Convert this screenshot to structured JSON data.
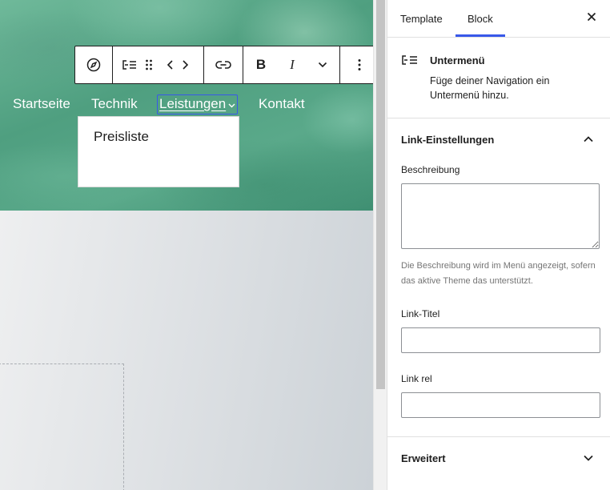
{
  "navigation": {
    "items": [
      "Startseite",
      "Technik",
      "Leistungen",
      "Kontakt"
    ],
    "active_item": "Leistungen",
    "submenu": {
      "items": [
        "Preisliste"
      ]
    }
  },
  "toolbar": {
    "buttons": [
      {
        "name": "navigation-block-icon",
        "icon": "compass-icon"
      },
      {
        "name": "submenu-parent-button",
        "icon": "submenu-icon"
      },
      {
        "name": "drag-handle",
        "icon": "drag-handle-icon"
      },
      {
        "name": "move-left-right",
        "icon": "chevron-left-right-icon"
      },
      {
        "name": "link-button",
        "icon": "link-icon"
      },
      {
        "name": "bold-button",
        "icon": "bold-icon",
        "label": "B"
      },
      {
        "name": "italic-button",
        "icon": "italic-icon",
        "label": "I"
      },
      {
        "name": "more-rich-text-button",
        "icon": "chevron-down-icon"
      },
      {
        "name": "options-button",
        "icon": "vertical-ellipsis-icon"
      }
    ]
  },
  "sidebar": {
    "tabs": [
      {
        "label": "Template",
        "active": false
      },
      {
        "label": "Block",
        "active": true
      }
    ],
    "close_icon": "close-icon",
    "block_card": {
      "icon": "submenu-icon",
      "title": "Untermenü",
      "description": "Füge deiner Navigation ein Untermenü hinzu."
    },
    "link_settings": {
      "title": "Link-Einstellungen",
      "expanded": true,
      "description_label": "Beschreibung",
      "description_value": "",
      "description_help": "Die Beschreibung wird im Menü angezeigt, sofern das aktive Theme das unterstützt.",
      "link_title_label": "Link-Titel",
      "link_title_value": "",
      "link_rel_label": "Link rel",
      "link_rel_value": ""
    },
    "advanced": {
      "title": "Erweitert",
      "expanded": false
    }
  },
  "colors": {
    "accent": "#3858e9",
    "hero_green": "#5aa98a",
    "text": "#1e1e1e",
    "help_text": "#757575"
  }
}
